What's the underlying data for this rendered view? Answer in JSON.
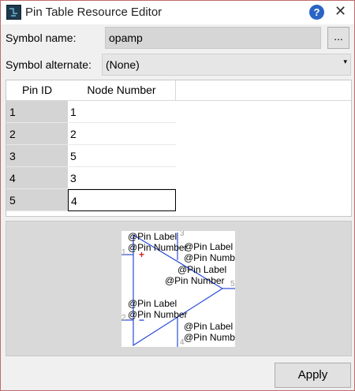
{
  "window": {
    "title": "Pin Table Resource Editor",
    "help_glyph": "?",
    "close_glyph": "✕"
  },
  "form": {
    "symbol_name_label": "Symbol name:",
    "symbol_name_value": "opamp",
    "browse_label": "...",
    "symbol_alternate_label": "Symbol alternate:",
    "symbol_alternate_value": "(None)"
  },
  "table": {
    "columns": [
      "Pin ID",
      "Node Number"
    ],
    "rows": [
      {
        "pin_id": "1",
        "node": "1"
      },
      {
        "pin_id": "2",
        "node": "2"
      },
      {
        "pin_id": "3",
        "node": "5"
      },
      {
        "pin_id": "4",
        "node": "3"
      },
      {
        "pin_id": "5",
        "node": "4"
      }
    ]
  },
  "preview": {
    "pin_label": "@Pin Label",
    "pin_number": "@Pin Number",
    "pin_numbers": [
      "1",
      "2",
      "3",
      "4",
      "5"
    ],
    "plus": "+",
    "minus": "−"
  },
  "apply_label": "Apply",
  "colors": {
    "symbol_line": "#2a4bd7",
    "plus": "#cc2222"
  }
}
